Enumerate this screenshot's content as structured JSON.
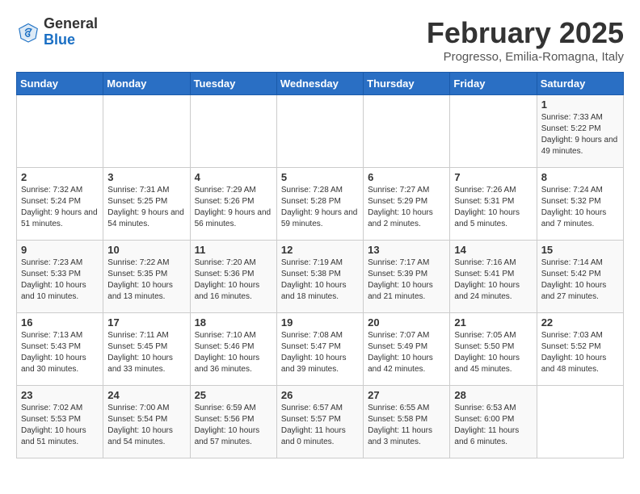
{
  "logo": {
    "general": "General",
    "blue": "Blue"
  },
  "title": "February 2025",
  "subtitle": "Progresso, Emilia-Romagna, Italy",
  "days_of_week": [
    "Sunday",
    "Monday",
    "Tuesday",
    "Wednesday",
    "Thursday",
    "Friday",
    "Saturday"
  ],
  "weeks": [
    [
      {
        "day": "",
        "detail": ""
      },
      {
        "day": "",
        "detail": ""
      },
      {
        "day": "",
        "detail": ""
      },
      {
        "day": "",
        "detail": ""
      },
      {
        "day": "",
        "detail": ""
      },
      {
        "day": "",
        "detail": ""
      },
      {
        "day": "1",
        "detail": "Sunrise: 7:33 AM\nSunset: 5:22 PM\nDaylight: 9 hours and 49 minutes."
      }
    ],
    [
      {
        "day": "2",
        "detail": "Sunrise: 7:32 AM\nSunset: 5:24 PM\nDaylight: 9 hours and 51 minutes."
      },
      {
        "day": "3",
        "detail": "Sunrise: 7:31 AM\nSunset: 5:25 PM\nDaylight: 9 hours and 54 minutes."
      },
      {
        "day": "4",
        "detail": "Sunrise: 7:29 AM\nSunset: 5:26 PM\nDaylight: 9 hours and 56 minutes."
      },
      {
        "day": "5",
        "detail": "Sunrise: 7:28 AM\nSunset: 5:28 PM\nDaylight: 9 hours and 59 minutes."
      },
      {
        "day": "6",
        "detail": "Sunrise: 7:27 AM\nSunset: 5:29 PM\nDaylight: 10 hours and 2 minutes."
      },
      {
        "day": "7",
        "detail": "Sunrise: 7:26 AM\nSunset: 5:31 PM\nDaylight: 10 hours and 5 minutes."
      },
      {
        "day": "8",
        "detail": "Sunrise: 7:24 AM\nSunset: 5:32 PM\nDaylight: 10 hours and 7 minutes."
      }
    ],
    [
      {
        "day": "9",
        "detail": "Sunrise: 7:23 AM\nSunset: 5:33 PM\nDaylight: 10 hours and 10 minutes."
      },
      {
        "day": "10",
        "detail": "Sunrise: 7:22 AM\nSunset: 5:35 PM\nDaylight: 10 hours and 13 minutes."
      },
      {
        "day": "11",
        "detail": "Sunrise: 7:20 AM\nSunset: 5:36 PM\nDaylight: 10 hours and 16 minutes."
      },
      {
        "day": "12",
        "detail": "Sunrise: 7:19 AM\nSunset: 5:38 PM\nDaylight: 10 hours and 18 minutes."
      },
      {
        "day": "13",
        "detail": "Sunrise: 7:17 AM\nSunset: 5:39 PM\nDaylight: 10 hours and 21 minutes."
      },
      {
        "day": "14",
        "detail": "Sunrise: 7:16 AM\nSunset: 5:41 PM\nDaylight: 10 hours and 24 minutes."
      },
      {
        "day": "15",
        "detail": "Sunrise: 7:14 AM\nSunset: 5:42 PM\nDaylight: 10 hours and 27 minutes."
      }
    ],
    [
      {
        "day": "16",
        "detail": "Sunrise: 7:13 AM\nSunset: 5:43 PM\nDaylight: 10 hours and 30 minutes."
      },
      {
        "day": "17",
        "detail": "Sunrise: 7:11 AM\nSunset: 5:45 PM\nDaylight: 10 hours and 33 minutes."
      },
      {
        "day": "18",
        "detail": "Sunrise: 7:10 AM\nSunset: 5:46 PM\nDaylight: 10 hours and 36 minutes."
      },
      {
        "day": "19",
        "detail": "Sunrise: 7:08 AM\nSunset: 5:47 PM\nDaylight: 10 hours and 39 minutes."
      },
      {
        "day": "20",
        "detail": "Sunrise: 7:07 AM\nSunset: 5:49 PM\nDaylight: 10 hours and 42 minutes."
      },
      {
        "day": "21",
        "detail": "Sunrise: 7:05 AM\nSunset: 5:50 PM\nDaylight: 10 hours and 45 minutes."
      },
      {
        "day": "22",
        "detail": "Sunrise: 7:03 AM\nSunset: 5:52 PM\nDaylight: 10 hours and 48 minutes."
      }
    ],
    [
      {
        "day": "23",
        "detail": "Sunrise: 7:02 AM\nSunset: 5:53 PM\nDaylight: 10 hours and 51 minutes."
      },
      {
        "day": "24",
        "detail": "Sunrise: 7:00 AM\nSunset: 5:54 PM\nDaylight: 10 hours and 54 minutes."
      },
      {
        "day": "25",
        "detail": "Sunrise: 6:59 AM\nSunset: 5:56 PM\nDaylight: 10 hours and 57 minutes."
      },
      {
        "day": "26",
        "detail": "Sunrise: 6:57 AM\nSunset: 5:57 PM\nDaylight: 11 hours and 0 minutes."
      },
      {
        "day": "27",
        "detail": "Sunrise: 6:55 AM\nSunset: 5:58 PM\nDaylight: 11 hours and 3 minutes."
      },
      {
        "day": "28",
        "detail": "Sunrise: 6:53 AM\nSunset: 6:00 PM\nDaylight: 11 hours and 6 minutes."
      },
      {
        "day": "",
        "detail": ""
      }
    ]
  ]
}
